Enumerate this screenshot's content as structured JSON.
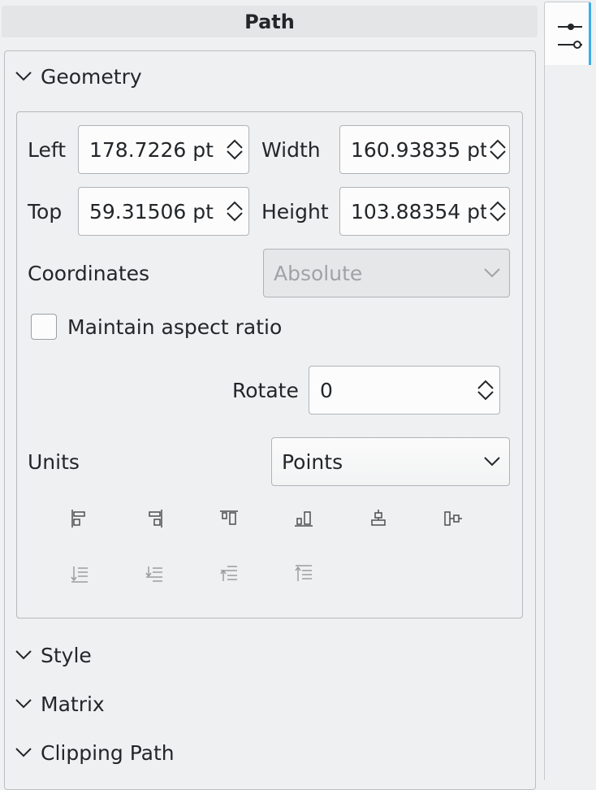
{
  "panel": {
    "title": "Path"
  },
  "sections": {
    "geometry": "Geometry",
    "style": "Style",
    "matrix": "Matrix",
    "clipping": "Clipping Path"
  },
  "geometry": {
    "left_label": "Left",
    "left_value": "178.7226 pt",
    "width_label": "Width",
    "width_value": "160.93835 pt",
    "top_label": "Top",
    "top_value": "59.31506 pt",
    "height_label": "Height",
    "height_value": "103.88354 pt",
    "coordinates_label": "Coordinates",
    "coordinates_value": "Absolute",
    "aspect_label": "Maintain aspect ratio",
    "aspect_checked": false,
    "rotate_label": "Rotate",
    "rotate_value": "0",
    "units_label": "Units",
    "units_value": "Points"
  },
  "icons": {
    "side_tab": "tool-options-sliders-icon",
    "align_row1": [
      "align-left-icon",
      "align-right-icon",
      "align-top-icon",
      "align-bottom-icon",
      "align-center-horizontal-icon",
      "align-center-vertical-icon"
    ],
    "align_row2": [
      "bring-to-front-icon",
      "raise-icon",
      "lower-icon",
      "send-to-back-icon"
    ]
  },
  "colors": {
    "accent": "#3daee9",
    "background": "#eff0f1",
    "field": "#fcfcfc"
  }
}
